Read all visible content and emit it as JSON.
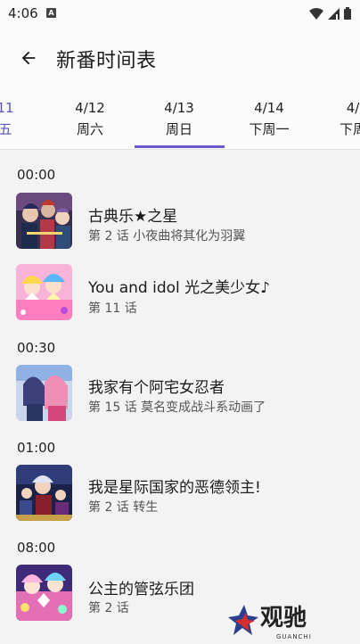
{
  "status": {
    "time": "4:06",
    "notification_glyph": "A"
  },
  "appbar": {
    "title": "新番时间表"
  },
  "tabs": [
    {
      "date": "11",
      "weekday": "五"
    },
    {
      "date": "4/12",
      "weekday": "周六"
    },
    {
      "date": "4/13",
      "weekday": "周日"
    },
    {
      "date": "4/14",
      "weekday": "下周一"
    },
    {
      "date": "4/",
      "weekday": "下周"
    }
  ],
  "selected_tab": "4/13",
  "schedule": {
    "slot1": "00:00",
    "slot2": "00:30",
    "slot3": "01:00",
    "slot4": "08:00",
    "items": [
      {
        "title": "古典乐★之星",
        "episode": "第 2 话  小夜曲将其化为羽翼"
      },
      {
        "title": "You and idol 光之美少女♪",
        "episode": "第 11 话"
      },
      {
        "title": "我家有个阿宅女忍者",
        "episode": "第 15 话  莫名变成战斗系动画了"
      },
      {
        "title": "我是星际国家的恶德领主!",
        "episode": "第 2 话  转生"
      },
      {
        "title": "公主的管弦乐团",
        "episode": "第 2 话"
      }
    ]
  },
  "watermark": {
    "text": "观驰",
    "sub": "GUANCHI"
  },
  "colors": {
    "accent": "#6a5acd",
    "background": "#f3f3f3"
  }
}
